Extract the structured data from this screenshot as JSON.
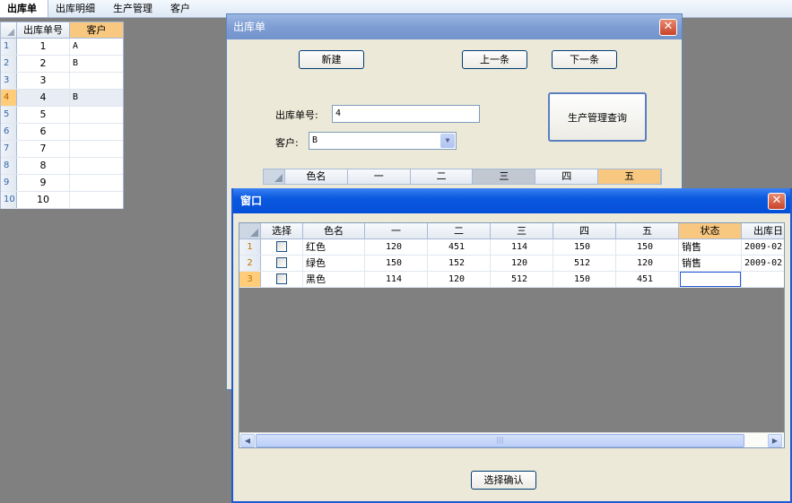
{
  "menu": {
    "items": [
      "出库单",
      "出库明细",
      "生产管理",
      "客户"
    ]
  },
  "left_grid": {
    "headers": [
      "出库单号",
      "客户"
    ],
    "rows": [
      {
        "num": "1",
        "id": "1",
        "customer": "A"
      },
      {
        "num": "2",
        "id": "2",
        "customer": "B"
      },
      {
        "num": "3",
        "id": "3",
        "customer": ""
      },
      {
        "num": "4",
        "id": "4",
        "customer": "B"
      },
      {
        "num": "5",
        "id": "5",
        "customer": ""
      },
      {
        "num": "6",
        "id": "6",
        "customer": ""
      },
      {
        "num": "7",
        "id": "7",
        "customer": ""
      },
      {
        "num": "8",
        "id": "8",
        "customer": ""
      },
      {
        "num": "9",
        "id": "9",
        "customer": ""
      },
      {
        "num": "10",
        "id": "10",
        "customer": ""
      }
    ]
  },
  "win1": {
    "title": "出库单",
    "close": "✕",
    "btn_new": "新建",
    "btn_prev": "上一条",
    "btn_next": "下一条",
    "btn_query": "生产管理查询",
    "label_id": "出库单号:",
    "value_id": "4",
    "label_customer": "客户:",
    "value_customer": "B",
    "grid_headers": [
      "色名",
      "一",
      "二",
      "三",
      "四",
      "五"
    ]
  },
  "win2": {
    "title": "窗口",
    "close": "✕",
    "grid_headers": [
      "选择",
      "色名",
      "一",
      "二",
      "三",
      "四",
      "五",
      "状态",
      "出库日"
    ],
    "rows": [
      {
        "num": "1",
        "name": "红色",
        "v1": "120",
        "v2": "451",
        "v3": "114",
        "v4": "150",
        "v5": "150",
        "state": "销售",
        "date": "2009-02"
      },
      {
        "num": "2",
        "name": "绿色",
        "v1": "150",
        "v2": "152",
        "v3": "120",
        "v4": "512",
        "v5": "120",
        "state": "销售",
        "date": "2009-02"
      },
      {
        "num": "3",
        "name": "黑色",
        "v1": "114",
        "v2": "120",
        "v3": "512",
        "v4": "150",
        "v5": "451",
        "state": "",
        "date": ""
      }
    ],
    "btn_confirm": "选择确认"
  },
  "icons": {
    "scroll_left": "◀",
    "scroll_right": "▶",
    "scroll_grip": "|||",
    "dropdown": "▼"
  }
}
